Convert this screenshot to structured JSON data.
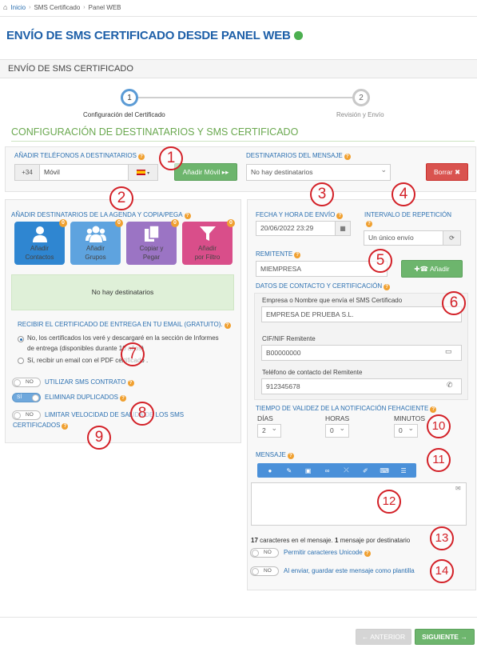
{
  "breadcrumb": {
    "home": "Inicio",
    "items": [
      "SMS Certificado",
      "Panel WEB"
    ]
  },
  "page_title": "ENVÍO DE SMS CERTIFICADO DESDE PANEL WEB",
  "section_title": "ENVÍO DE SMS CERTIFICADO",
  "wizard": {
    "steps": [
      {
        "number": "1",
        "label": "Configuración del Certificado"
      },
      {
        "number": "2",
        "label": "Revisión y Envío"
      }
    ]
  },
  "config_heading": "CONFIGURACIÓN DE DESTINATARIOS Y SMS CERTIFICADO",
  "phones": {
    "label": "AÑADIR TELÉFONOS A DESTINATARIOS",
    "prefix": "+34",
    "mobile_placeholder": "Móvil",
    "add_button": "Añadir Móvil",
    "dest_label": "DESTINATARIOS DEL MENSAJE",
    "dest_select": "No hay destinatarios",
    "delete_button": "Borrar"
  },
  "agenda": {
    "label": "AÑADIR DESTINATARIOS DE LA AGENDA Y COPIA/PEGA",
    "tiles": [
      {
        "label1": "Añadir",
        "label2": "Contactos",
        "badge": "0",
        "color": "#2f86d1"
      },
      {
        "label1": "Añadir",
        "label2": "Grupos",
        "badge": "0",
        "color": "#5ea3df"
      },
      {
        "label1": "Copiar y",
        "label2": "Pegar",
        "badge": "0",
        "color": "#9b74c4"
      },
      {
        "label1": "Añadir",
        "label2": "por Filtro",
        "badge": "0",
        "color": "#d94e8a"
      }
    ],
    "empty": "No hay destinatarios"
  },
  "certificate_email": {
    "label": "RECIBIR EL CERTIFICADO DE ENTREGA EN TU EMAIL (GRATUITO).",
    "option_no_1": "No, los certificados los veré y descargaré en la sección de Informes",
    "option_no_2": "de entrega (disponibles durante 10 años)",
    "option_yes": "Sí, recibir un email con el PDF certificado ."
  },
  "toggles": {
    "contract": {
      "state": "NO",
      "label": "UTILIZAR SMS CONTRATO"
    },
    "duplicates": {
      "state": "SÍ",
      "label": "ELIMINAR DUPLICADOS"
    },
    "speed": {
      "state": "NO",
      "label1": "LIMITAR VELOCIDAD DE SALIDA DE LOS SMS",
      "label2": "CERTIFICADOS"
    }
  },
  "send": {
    "date_label": "FECHA Y HORA DE ENVÍO",
    "date_value": "20/06/2022 23:29",
    "interval_label": "INTERVALO DE REPETICIÓN",
    "interval_value": "Un único envío",
    "sender_label": "REMITENTE",
    "sender_value": "MIEMPRESA",
    "sender_add": "Añadir"
  },
  "contact": {
    "label": "DATOS DE CONTACTO Y CERTIFICACIÓN",
    "company_label": "Empresa o Nombre que envía el SMS Certificado",
    "company_value": "EMPRESA DE PRUEBA S.L.",
    "cif_label": "CIF/NIF Remitente",
    "cif_value": "B00000000",
    "phone_label": "Teléfono de contacto del Remitente",
    "phone_value": "912345678"
  },
  "validity": {
    "label": "TIEMPO DE VALIDEZ DE LA NOTIFICACIÓN FEHACIENTE",
    "days_label": "DÍAS",
    "days_value": "2",
    "hours_label": "HORAS",
    "hours_value": "0",
    "minutes_label": "MINUTOS",
    "minutes_value": "0"
  },
  "message": {
    "label": "MENSAJE",
    "count_num": "17",
    "count_text": " caracteres en el mensaje. ",
    "msg_num": "1",
    "msg_text": " mensaje por destinatario",
    "unicode": {
      "state": "NO",
      "label": "Permitir caracteres Unicode"
    },
    "template": {
      "state": "NO",
      "label": "Al enviar, guardar este mensaje como plantilla"
    }
  },
  "footer": {
    "prev": "ANTERIOR",
    "next": "SIGUIENTE"
  },
  "markers": [
    "1",
    "2",
    "3",
    "4",
    "5",
    "6",
    "7",
    "8",
    "9",
    "10",
    "11",
    "12",
    "13",
    "14"
  ]
}
